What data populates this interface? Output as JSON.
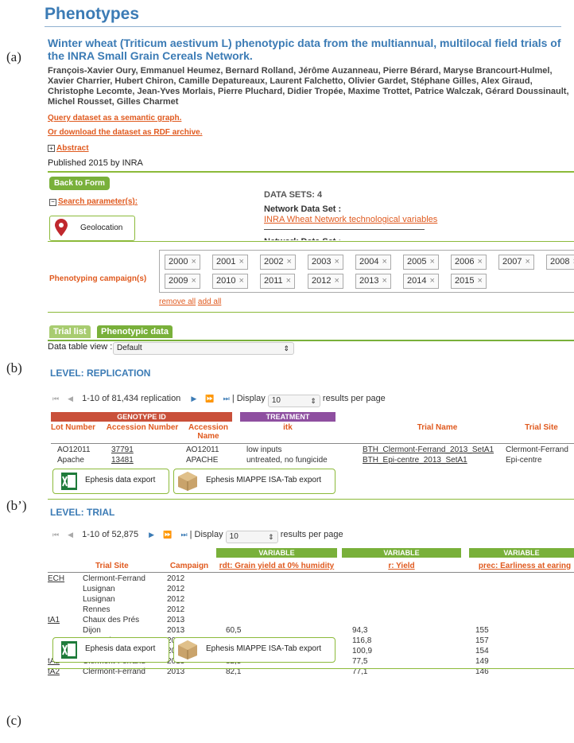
{
  "labels": {
    "a": "(a)",
    "b": "(b)",
    "b2": "(b’)",
    "c": "(c)"
  },
  "page_title": "Phenotypes",
  "dataset": {
    "title": "Winter wheat (Triticum aestivum L) phenotypic data from the multiannual, multilocal field trials of the INRA Small Grain Cereals Network.",
    "authors": "François-Xavier Oury, Emmanuel Heumez, Bernard Rolland, Jérôme Auzanneau, Pierre Bérard, Maryse Brancourt-Hulmel, Xavier Charrier, Hubert Chiron, Camille Depatureaux, Laurent Falchetto, Olivier Gardet, Stéphane Gilles, Alex Giraud, Christophe Lecomte, Jean-Yves Morlais, Pierre Pluchard, Didier Tropée, Maxime Trottet, Patrice Walczak, Gérard Doussinault, Michel Rousset, Gilles Charmet",
    "query_link": "Query dataset as a semantic graph.",
    "download_link": "Or download the dataset as RDF archive.",
    "abstract_label": "Abstract",
    "published": "Published 2015 by INRA"
  },
  "form": {
    "back_button": "Back to Form",
    "search_params": "Search parameter(s):",
    "geolocation": "Geolocation",
    "datasets_count": "DATA SETS: 4",
    "network_dataset_label": "Network Data Set :",
    "network_dataset_link": "INRA Wheat Network technological variables",
    "network_dataset_label2": "Network Data Set :",
    "campaign_label": "Phenotyping campaign(s)",
    "years": [
      "2000",
      "2001",
      "2002",
      "2003",
      "2004",
      "2005",
      "2006",
      "2007",
      "2008",
      "2009",
      "2010",
      "2011",
      "2012",
      "2013",
      "2014",
      "2015"
    ],
    "remove_all": "remove all",
    "add_all": "add all"
  },
  "tabs": {
    "trial_list": "Trial list",
    "phenotypic": "Phenotypic data"
  },
  "view": {
    "label": "Data table view :",
    "value": "Default"
  },
  "replication": {
    "level": "LEVEL: REPLICATION",
    "pager_text": "1-10 of 81,434 replication",
    "display": "| Display",
    "per_page": "10",
    "per_page_suffix": "results per page",
    "group_genotype": "GENOTYPE ID",
    "group_treatment": "TREATMENT",
    "headers": [
      "Lot Number",
      "Accession Number",
      "Accession Name",
      "itk",
      "Trial Name",
      "Trial Site"
    ],
    "rows": [
      [
        "AO12011",
        "37791",
        "AO12011",
        "low inputs",
        "BTH_Clermont-Ferrand_2013_SetA1",
        "Clermont-Ferrand"
      ],
      [
        "Apache",
        "13481",
        "APACHE",
        "untreated, no fungicide",
        "BTH_Epi-centre_2013_SetA1",
        "Epi-centre"
      ]
    ]
  },
  "trial": {
    "level": "LEVEL: TRIAL",
    "pager_text": "1-10 of 52,875",
    "display": "| Display",
    "per_page": "10",
    "per_page_suffix": "results per page",
    "group_variable": "VARIABLE",
    "headers": [
      "Trial Site",
      "Campaign",
      "rdt: Grain yield at 0% humidity",
      "r: Yield",
      "prec: Earliness at earing"
    ],
    "rows": [
      {
        "trial": "ECH",
        "site": "Clermont-Ferrand",
        "campaign": "2012",
        "rdt": "",
        "r": "",
        "prec": ""
      },
      {
        "trial": "",
        "site": "Lusignan",
        "campaign": "2012",
        "rdt": "",
        "r": "",
        "prec": ""
      },
      {
        "trial": "",
        "site": "Lusignan",
        "campaign": "2012",
        "rdt": "",
        "r": "",
        "prec": ""
      },
      {
        "trial": "",
        "site": "Rennes",
        "campaign": "2012",
        "rdt": "",
        "r": "",
        "prec": ""
      },
      {
        "trial": "tA1",
        "site": "Chaux des Prés",
        "campaign": "2013",
        "rdt": "",
        "r": "",
        "prec": ""
      },
      {
        "trial": "",
        "site": "Dijon",
        "campaign": "2013",
        "rdt": "60,5",
        "r": "94,3",
        "prec": "155"
      },
      {
        "trial": "",
        "site": "Le Moulon",
        "campaign": "2013",
        "rdt": "108,4",
        "r": "116,8",
        "prec": "157"
      },
      {
        "trial": "",
        "site": "Le Moulon",
        "campaign": "2013",
        "rdt": "105,4",
        "r": "100,9",
        "prec": "154"
      },
      {
        "trial": "tA2",
        "site": "Clermont-Ferrand",
        "campaign": "2013",
        "rdt": "82,5",
        "r": "77,5",
        "prec": "149"
      },
      {
        "trial": "tA2",
        "site": "Clermont-Ferrand",
        "campaign": "2013",
        "rdt": "82,1",
        "r": "77,1",
        "prec": "146"
      }
    ]
  },
  "export": {
    "ephesis": "Ephesis data export",
    "miappe": "Ephesis MIAPPE ISA-Tab export"
  },
  "colors": {
    "blue": "#3b7bb5",
    "orange": "#e05a1f",
    "green": "#79b03a",
    "red_header": "#c9503a",
    "purple_header": "#8e4fa0"
  }
}
